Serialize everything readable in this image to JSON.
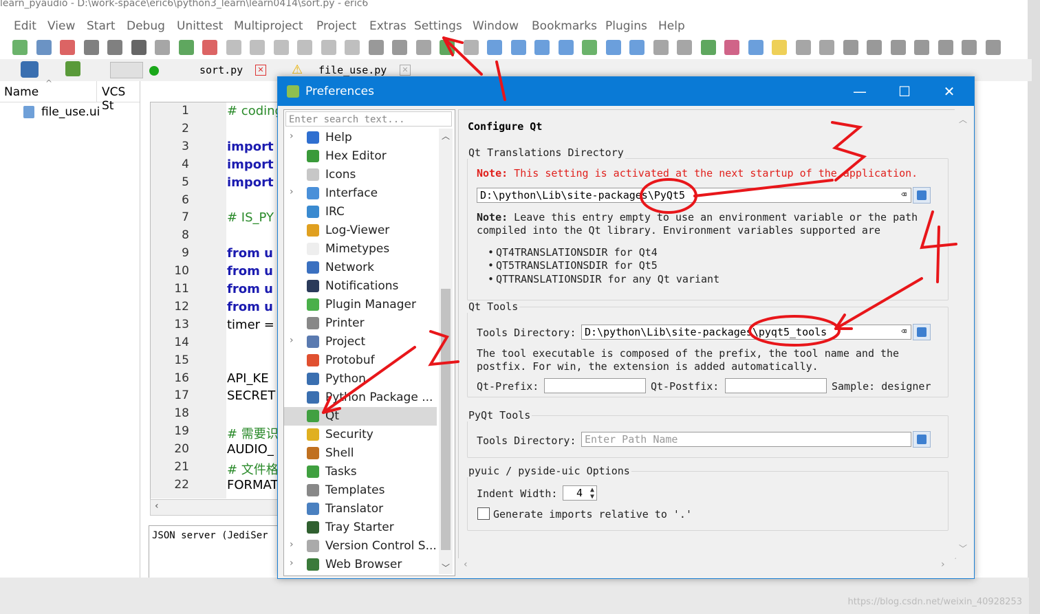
{
  "window": {
    "title": "learn_pyaudio - D:\\work-space\\eric6\\python3_learn\\learn0414\\sort.py - eric6",
    "menu": [
      "Edit",
      "View",
      "Start",
      "Debug",
      "Unittest",
      "Multiproject",
      "Project",
      "Extras",
      "Settings",
      "Window",
      "Bookmarks",
      "Plugins",
      "Help"
    ]
  },
  "tabs": {
    "sort": "sort.py",
    "file_use": "file_use.py"
  },
  "project_browser": {
    "col_name": "Name",
    "col_vcs": "VCS St",
    "file": "file_use.ui"
  },
  "editor": {
    "lines": [
      "1",
      "2",
      "3",
      "4",
      "5",
      "6",
      "7",
      "8",
      "9",
      "10",
      "11",
      "12",
      "13",
      "14",
      "15",
      "16",
      "17",
      "18",
      "19",
      "20",
      "21",
      "22"
    ],
    "code": [
      {
        "t": "# coding:",
        "c": "#2a8a2a"
      },
      {
        "t": "",
        "c": "#000"
      },
      {
        "t": "import",
        "c": "#1b1bb0"
      },
      {
        "t": "import",
        "c": "#1b1bb0"
      },
      {
        "t": "import",
        "c": "#1b1bb0"
      },
      {
        "t": "",
        "c": "#000"
      },
      {
        "t": "# IS_PY",
        "c": "#2a8a2a"
      },
      {
        "t": "",
        "c": "#000"
      },
      {
        "t": "from u",
        "c": "#1b1bb0"
      },
      {
        "t": "from u",
        "c": "#1b1bb0"
      },
      {
        "t": "from u",
        "c": "#1b1bb0"
      },
      {
        "t": "from u",
        "c": "#1b1bb0"
      },
      {
        "t": "timer =",
        "c": "#000"
      },
      {
        "t": "",
        "c": "#000"
      },
      {
        "t": "",
        "c": "#000"
      },
      {
        "t": "API_KE",
        "c": "#000"
      },
      {
        "t": "SECRET",
        "c": "#000"
      },
      {
        "t": "",
        "c": "#000"
      },
      {
        "t": "# 需要识",
        "c": "#2a8a2a"
      },
      {
        "t": "AUDIO_",
        "c": "#000"
      },
      {
        "t": "# 文件格",
        "c": "#2a8a2a"
      },
      {
        "t": "FORMAT",
        "c": "#000"
      }
    ],
    "bottom_text": "JSON server (JediSer"
  },
  "dialog": {
    "title": "Preferences",
    "search_placeholder": "Enter search text...",
    "nav": [
      {
        "label": "Help",
        "exp": true,
        "color": "#2f6fd0"
      },
      {
        "label": "Hex Editor",
        "exp": false,
        "color": "#3a9a3a"
      },
      {
        "label": "Icons",
        "exp": false,
        "color": "#c7c7c7"
      },
      {
        "label": "Interface",
        "exp": true,
        "color": "#4a90d9"
      },
      {
        "label": "IRC",
        "exp": false,
        "color": "#3a8ad0"
      },
      {
        "label": "Log-Viewer",
        "exp": false,
        "color": "#e0a020"
      },
      {
        "label": "Mimetypes",
        "exp": false,
        "color": "#eeeeee"
      },
      {
        "label": "Network",
        "exp": false,
        "color": "#3a70c0"
      },
      {
        "label": "Notifications",
        "exp": false,
        "color": "#2a3a5a"
      },
      {
        "label": "Plugin Manager",
        "exp": false,
        "color": "#4ab04a"
      },
      {
        "label": "Printer",
        "exp": false,
        "color": "#888888"
      },
      {
        "label": "Project",
        "exp": true,
        "color": "#5a7ab0"
      },
      {
        "label": "Protobuf",
        "exp": false,
        "color": "#e05030"
      },
      {
        "label": "Python",
        "exp": false,
        "color": "#3a6fb0"
      },
      {
        "label": "Python Package ...",
        "exp": false,
        "color": "#3a6fb0"
      },
      {
        "label": "Qt",
        "exp": false,
        "color": "#41a041",
        "selected": true
      },
      {
        "label": "Security",
        "exp": false,
        "color": "#e0b020"
      },
      {
        "label": "Shell",
        "exp": false,
        "color": "#c07020"
      },
      {
        "label": "Tasks",
        "exp": false,
        "color": "#40a040"
      },
      {
        "label": "Templates",
        "exp": false,
        "color": "#888888"
      },
      {
        "label": "Translator",
        "exp": false,
        "color": "#4a80c0"
      },
      {
        "label": "Tray Starter",
        "exp": false,
        "color": "#306030"
      },
      {
        "label": "Version Control S...",
        "exp": true,
        "color": "#aaaaaa"
      },
      {
        "label": "Web Browser",
        "exp": true,
        "color": "#3a7a3a"
      }
    ],
    "page": {
      "title": "Configure Qt",
      "translations": {
        "group_title": "Qt Translations Directory",
        "note_label": "Note:",
        "note_text": " This setting is activated at the next startup of the application.",
        "value": "D:\\python\\Lib\\site-packages\\PyQt5",
        "hint_label": "Note:",
        "hint_text": " Leave this entry empty to use an environment variable or the path",
        "hint_text2": "compiled into the Qt library. Environment variables supported are",
        "env": [
          "QT4TRANSLATIONSDIR for Qt4",
          "QT5TRANSLATIONSDIR for Qt5",
          "QTTRANSLATIONSDIR for any Qt variant"
        ]
      },
      "qt_tools": {
        "group_title": "Qt Tools",
        "dir_label": "Tools Directory:",
        "dir_value": "D:\\python\\Lib\\site-packages\\pyqt5_tools",
        "desc1": "The tool executable is composed of the prefix, the tool name and the",
        "desc2": "postfix. For win, the extension is added automatically.",
        "prefix_label": "Qt-Prefix:",
        "postfix_label": "Qt-Postfix:",
        "sample": "Sample: designer"
      },
      "pyqt_tools": {
        "group_title": "PyQt Tools",
        "dir_label": "Tools Directory:",
        "dir_placeholder": "Enter Path Name"
      },
      "pyuic": {
        "group_title": "pyuic / pyside-uic Options",
        "indent_label": "Indent Width:",
        "indent_value": "4",
        "relative_label": "Generate imports relative to '.'"
      }
    }
  },
  "annotations": [
    "1",
    "2",
    "3",
    "4"
  ],
  "watermark": "https://blog.csdn.net/weixin_40928253",
  "colors": {
    "accent": "#0a7ad6",
    "annotation": "#e8161a",
    "note": "#e0201c"
  }
}
